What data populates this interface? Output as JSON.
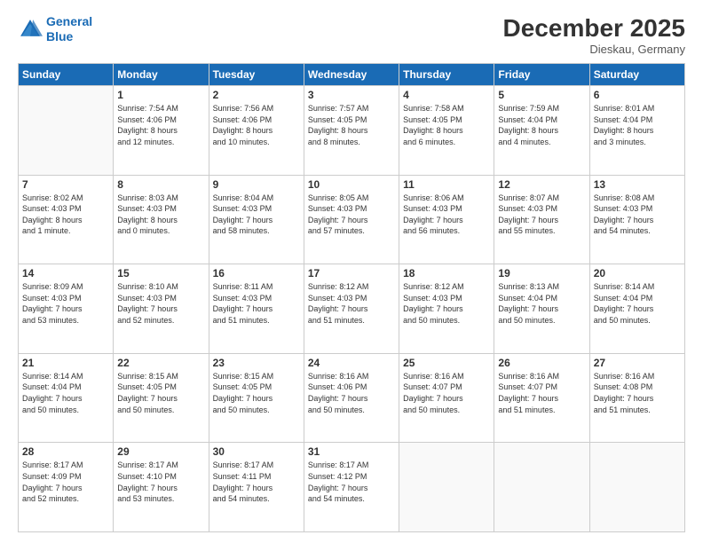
{
  "header": {
    "logo_line1": "General",
    "logo_line2": "Blue",
    "month": "December 2025",
    "location": "Dieskau, Germany"
  },
  "days_of_week": [
    "Sunday",
    "Monday",
    "Tuesday",
    "Wednesday",
    "Thursday",
    "Friday",
    "Saturday"
  ],
  "weeks": [
    [
      {
        "day": "",
        "info": ""
      },
      {
        "day": "1",
        "info": "Sunrise: 7:54 AM\nSunset: 4:06 PM\nDaylight: 8 hours\nand 12 minutes."
      },
      {
        "day": "2",
        "info": "Sunrise: 7:56 AM\nSunset: 4:06 PM\nDaylight: 8 hours\nand 10 minutes."
      },
      {
        "day": "3",
        "info": "Sunrise: 7:57 AM\nSunset: 4:05 PM\nDaylight: 8 hours\nand 8 minutes."
      },
      {
        "day": "4",
        "info": "Sunrise: 7:58 AM\nSunset: 4:05 PM\nDaylight: 8 hours\nand 6 minutes."
      },
      {
        "day": "5",
        "info": "Sunrise: 7:59 AM\nSunset: 4:04 PM\nDaylight: 8 hours\nand 4 minutes."
      },
      {
        "day": "6",
        "info": "Sunrise: 8:01 AM\nSunset: 4:04 PM\nDaylight: 8 hours\nand 3 minutes."
      }
    ],
    [
      {
        "day": "7",
        "info": "Sunrise: 8:02 AM\nSunset: 4:03 PM\nDaylight: 8 hours\nand 1 minute."
      },
      {
        "day": "8",
        "info": "Sunrise: 8:03 AM\nSunset: 4:03 PM\nDaylight: 8 hours\nand 0 minutes."
      },
      {
        "day": "9",
        "info": "Sunrise: 8:04 AM\nSunset: 4:03 PM\nDaylight: 7 hours\nand 58 minutes."
      },
      {
        "day": "10",
        "info": "Sunrise: 8:05 AM\nSunset: 4:03 PM\nDaylight: 7 hours\nand 57 minutes."
      },
      {
        "day": "11",
        "info": "Sunrise: 8:06 AM\nSunset: 4:03 PM\nDaylight: 7 hours\nand 56 minutes."
      },
      {
        "day": "12",
        "info": "Sunrise: 8:07 AM\nSunset: 4:03 PM\nDaylight: 7 hours\nand 55 minutes."
      },
      {
        "day": "13",
        "info": "Sunrise: 8:08 AM\nSunset: 4:03 PM\nDaylight: 7 hours\nand 54 minutes."
      }
    ],
    [
      {
        "day": "14",
        "info": "Sunrise: 8:09 AM\nSunset: 4:03 PM\nDaylight: 7 hours\nand 53 minutes."
      },
      {
        "day": "15",
        "info": "Sunrise: 8:10 AM\nSunset: 4:03 PM\nDaylight: 7 hours\nand 52 minutes."
      },
      {
        "day": "16",
        "info": "Sunrise: 8:11 AM\nSunset: 4:03 PM\nDaylight: 7 hours\nand 51 minutes."
      },
      {
        "day": "17",
        "info": "Sunrise: 8:12 AM\nSunset: 4:03 PM\nDaylight: 7 hours\nand 51 minutes."
      },
      {
        "day": "18",
        "info": "Sunrise: 8:12 AM\nSunset: 4:03 PM\nDaylight: 7 hours\nand 50 minutes."
      },
      {
        "day": "19",
        "info": "Sunrise: 8:13 AM\nSunset: 4:04 PM\nDaylight: 7 hours\nand 50 minutes."
      },
      {
        "day": "20",
        "info": "Sunrise: 8:14 AM\nSunset: 4:04 PM\nDaylight: 7 hours\nand 50 minutes."
      }
    ],
    [
      {
        "day": "21",
        "info": "Sunrise: 8:14 AM\nSunset: 4:04 PM\nDaylight: 7 hours\nand 50 minutes."
      },
      {
        "day": "22",
        "info": "Sunrise: 8:15 AM\nSunset: 4:05 PM\nDaylight: 7 hours\nand 50 minutes."
      },
      {
        "day": "23",
        "info": "Sunrise: 8:15 AM\nSunset: 4:05 PM\nDaylight: 7 hours\nand 50 minutes."
      },
      {
        "day": "24",
        "info": "Sunrise: 8:16 AM\nSunset: 4:06 PM\nDaylight: 7 hours\nand 50 minutes."
      },
      {
        "day": "25",
        "info": "Sunrise: 8:16 AM\nSunset: 4:07 PM\nDaylight: 7 hours\nand 50 minutes."
      },
      {
        "day": "26",
        "info": "Sunrise: 8:16 AM\nSunset: 4:07 PM\nDaylight: 7 hours\nand 51 minutes."
      },
      {
        "day": "27",
        "info": "Sunrise: 8:16 AM\nSunset: 4:08 PM\nDaylight: 7 hours\nand 51 minutes."
      }
    ],
    [
      {
        "day": "28",
        "info": "Sunrise: 8:17 AM\nSunset: 4:09 PM\nDaylight: 7 hours\nand 52 minutes."
      },
      {
        "day": "29",
        "info": "Sunrise: 8:17 AM\nSunset: 4:10 PM\nDaylight: 7 hours\nand 53 minutes."
      },
      {
        "day": "30",
        "info": "Sunrise: 8:17 AM\nSunset: 4:11 PM\nDaylight: 7 hours\nand 54 minutes."
      },
      {
        "day": "31",
        "info": "Sunrise: 8:17 AM\nSunset: 4:12 PM\nDaylight: 7 hours\nand 54 minutes."
      },
      {
        "day": "",
        "info": ""
      },
      {
        "day": "",
        "info": ""
      },
      {
        "day": "",
        "info": ""
      }
    ]
  ]
}
